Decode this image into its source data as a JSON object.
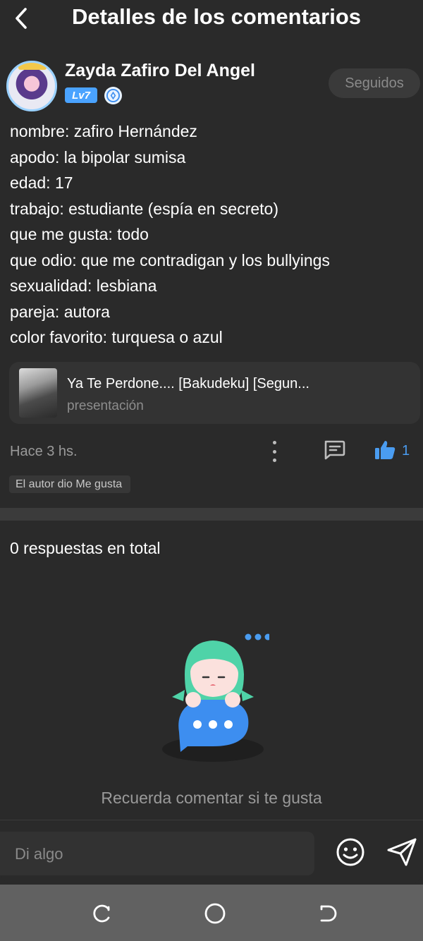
{
  "header": {
    "title": "Detalles de los comentarios",
    "back_icon": "chevron-left-icon"
  },
  "author": {
    "name": "Zayda Zafiro Del Angel",
    "level": "Lv7",
    "follow_label": "Seguidos"
  },
  "bio_lines": [
    "nombre: zafiro Hernández",
    "apodo: la bipolar sumisa",
    "edad: 17",
    "trabajo: estudiante (espía en secreto)",
    "que me gusta: todo",
    "que odio: que me contradigan y los bullyings",
    "sexualidad: lesbiana",
    "pareja: autora",
    "color favorito: turquesa o azul"
  ],
  "link_card": {
    "title": "Ya Te Perdone.... [Bakudeku] [Segun...",
    "subtitle": "presentación"
  },
  "meta": {
    "time": "Hace 3 hs.",
    "like_count": "1",
    "author_liked": "El autor dio Me gusta"
  },
  "replies": {
    "count_label": "0 respuestas en total",
    "empty_text": "Recuerda comentar si te gusta"
  },
  "composer": {
    "placeholder": "Di algo"
  },
  "colors": {
    "background": "#2a2a2a",
    "accent": "#4a9cf0",
    "level_badge": "#4aa3ff",
    "nav_bar": "#616161"
  }
}
